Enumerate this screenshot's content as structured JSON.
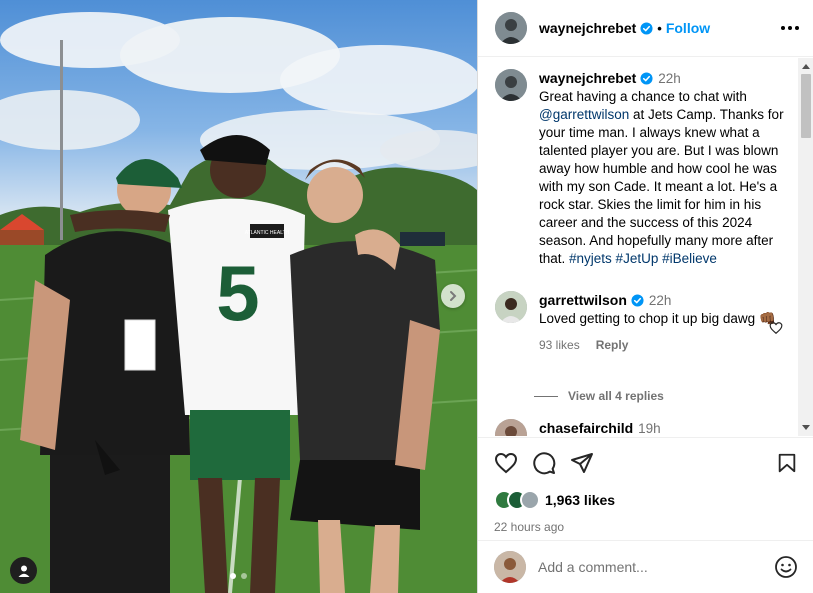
{
  "post": {
    "author": "waynejchrebet",
    "follow_label": "Follow",
    "separator": "•",
    "more_icon": "more-horizontal-icon"
  },
  "photo": {
    "jersey_number": "5",
    "patch_text": "ATLANTIC HEALTH",
    "carousel_total": 2,
    "carousel_active": 1
  },
  "caption": {
    "author": "waynejchrebet",
    "time": "22h",
    "text_before": "Great having a chance to chat with ",
    "mention": "@garrettwilson",
    "text_middle": " at Jets Camp. Thanks for your time man. I always knew what a talented player you are. But I was blown away how humble and how cool he was with my son Cade. It meant a lot. He's a rock star. Skies the limit for him in his career and the success of this 2024 season. And hopefully many more after that. ",
    "hashtags": "#nyjets #JetUp #iBelieve"
  },
  "comments": [
    {
      "author": "garrettwilson",
      "time": "22h",
      "text": "Loved getting to chop it up big dawg",
      "emoji": "👊🏾",
      "likes": "93 likes",
      "reply_label": "Reply",
      "view_replies": "View all 4 replies"
    },
    {
      "author": "chasefairchild",
      "time": "19h"
    }
  ],
  "engagement": {
    "likes": "1,963 likes",
    "posted": "22 hours ago"
  },
  "composer": {
    "placeholder": "Add a comment..."
  },
  "colors": {
    "link": "#00376b",
    "follow": "#0095f6",
    "verified": "#0095f6",
    "muted": "#737373",
    "jets_green": "#1c5e37"
  }
}
